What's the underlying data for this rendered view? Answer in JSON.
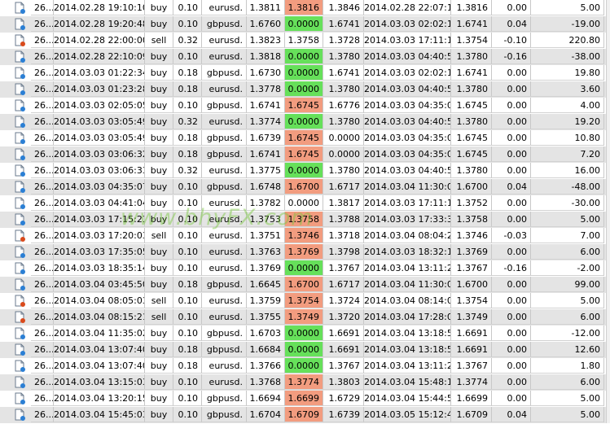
{
  "watermark": "www.bhyFX.com",
  "colors": {
    "loss_highlight": "#f29c7f",
    "profit_highlight": "#66e05a",
    "alt_row": "#e4e4e4"
  },
  "rows": [
    {
      "ticket": "26...",
      "open_time": "2014.02.28 19:10:10",
      "type": "buy",
      "size": "0.10",
      "symbol": "eurusd.",
      "open_price": "1.3811",
      "sl": "1.3816",
      "tp": "1.3846",
      "close_time": "2014.02.28 22:07:17",
      "close_price": "1.3816",
      "commission": "0.00",
      "profit": "5.00",
      "hl": "sl-red",
      "icon": "trade-doc-icon"
    },
    {
      "ticket": "26...",
      "open_time": "2014.02.28 19:20:48",
      "type": "buy",
      "size": "0.10",
      "symbol": "gbpusd.",
      "open_price": "1.6760",
      "sl": "0.0000",
      "tp": "1.6741",
      "close_time": "2014.03.03 02:02:10",
      "close_price": "1.6741",
      "commission": "0.04",
      "profit": "-19.00",
      "hl": "tp-green",
      "icon": "trade-doc-icon"
    },
    {
      "ticket": "26...",
      "open_time": "2014.02.28 22:00:00",
      "type": "sell",
      "size": "0.32",
      "symbol": "eurusd.",
      "open_price": "1.3823",
      "sl": "1.3758",
      "tp": "1.3728",
      "close_time": "2014.03.03 17:11:18",
      "close_price": "1.3754",
      "commission": "-0.10",
      "profit": "220.80",
      "hl": "",
      "icon": "trade-doc-sell-icon"
    },
    {
      "ticket": "26...",
      "open_time": "2014.02.28 22:10:09",
      "type": "buy",
      "size": "0.10",
      "symbol": "eurusd.",
      "open_price": "1.3818",
      "sl": "0.0000",
      "tp": "1.3780",
      "close_time": "2014.03.03 04:40:55",
      "close_price": "1.3780",
      "commission": "-0.16",
      "profit": "-38.00",
      "hl": "tp-green",
      "icon": "trade-doc-icon"
    },
    {
      "ticket": "26...",
      "open_time": "2014.03.03 01:22:34",
      "type": "buy",
      "size": "0.18",
      "symbol": "gbpusd.",
      "open_price": "1.6730",
      "sl": "0.0000",
      "tp": "1.6741",
      "close_time": "2014.03.03 02:02:10",
      "close_price": "1.6741",
      "commission": "0.00",
      "profit": "19.80",
      "hl": "tp-green",
      "icon": "trade-doc-icon"
    },
    {
      "ticket": "26...",
      "open_time": "2014.03.03 01:23:28",
      "type": "buy",
      "size": "0.18",
      "symbol": "eurusd.",
      "open_price": "1.3778",
      "sl": "0.0000",
      "tp": "1.3780",
      "close_time": "2014.03.03 04:40:55",
      "close_price": "1.3780",
      "commission": "0.00",
      "profit": "3.60",
      "hl": "tp-green",
      "icon": "trade-doc-icon"
    },
    {
      "ticket": "26...",
      "open_time": "2014.03.03 02:05:05",
      "type": "buy",
      "size": "0.10",
      "symbol": "gbpusd.",
      "open_price": "1.6741",
      "sl": "1.6745",
      "tp": "1.6776",
      "close_time": "2014.03.03 04:35:00",
      "close_price": "1.6745",
      "commission": "0.00",
      "profit": "4.00",
      "hl": "sl-red",
      "icon": "trade-doc-icon"
    },
    {
      "ticket": "26...",
      "open_time": "2014.03.03 03:05:49",
      "type": "buy",
      "size": "0.32",
      "symbol": "eurusd.",
      "open_price": "1.3774",
      "sl": "0.0000",
      "tp": "1.3780",
      "close_time": "2014.03.03 04:40:55",
      "close_price": "1.3780",
      "commission": "0.00",
      "profit": "19.20",
      "hl": "tp-green",
      "icon": "trade-doc-icon"
    },
    {
      "ticket": "26...",
      "open_time": "2014.03.03 03:05:49",
      "type": "buy",
      "size": "0.18",
      "symbol": "gbpusd.",
      "open_price": "1.6739",
      "sl": "1.6745",
      "tp": "0.0000",
      "close_time": "2014.03.03 04:35:00",
      "close_price": "1.6745",
      "commission": "0.00",
      "profit": "10.80",
      "hl": "sl-red",
      "icon": "trade-doc-icon"
    },
    {
      "ticket": "26...",
      "open_time": "2014.03.03 03:06:32",
      "type": "buy",
      "size": "0.18",
      "symbol": "gbpusd.",
      "open_price": "1.6741",
      "sl": "1.6745",
      "tp": "0.0000",
      "close_time": "2014.03.03 04:35:00",
      "close_price": "1.6745",
      "commission": "0.00",
      "profit": "7.20",
      "hl": "sl-red",
      "icon": "trade-doc-icon"
    },
    {
      "ticket": "26...",
      "open_time": "2014.03.03 03:06:33",
      "type": "buy",
      "size": "0.32",
      "symbol": "eurusd.",
      "open_price": "1.3775",
      "sl": "0.0000",
      "tp": "1.3780",
      "close_time": "2014.03.03 04:40:55",
      "close_price": "1.3780",
      "commission": "0.00",
      "profit": "16.00",
      "hl": "tp-green",
      "icon": "trade-doc-icon"
    },
    {
      "ticket": "26...",
      "open_time": "2014.03.03 04:35:07",
      "type": "buy",
      "size": "0.10",
      "symbol": "gbpusd.",
      "open_price": "1.6748",
      "sl": "1.6700",
      "tp": "1.6717",
      "close_time": "2014.03.04 11:30:00",
      "close_price": "1.6700",
      "commission": "0.04",
      "profit": "-48.00",
      "hl": "sl-red",
      "icon": "trade-doc-icon"
    },
    {
      "ticket": "26...",
      "open_time": "2014.03.03 04:41:04",
      "type": "buy",
      "size": "0.10",
      "symbol": "eurusd.",
      "open_price": "1.3782",
      "sl": "0.0000",
      "tp": "1.3817",
      "close_time": "2014.03.03 17:11:18",
      "close_price": "1.3752",
      "commission": "0.00",
      "profit": "-30.00",
      "hl": "",
      "icon": "trade-doc-icon"
    },
    {
      "ticket": "26...",
      "open_time": "2014.03.03 17:15:23",
      "type": "buy",
      "size": "0.10",
      "symbol": "eurusd.",
      "open_price": "1.3753",
      "sl": "1.3758",
      "tp": "1.3788",
      "close_time": "2014.03.03 17:33:36",
      "close_price": "1.3758",
      "commission": "0.00",
      "profit": "5.00",
      "hl": "sl-red",
      "icon": "trade-doc-icon"
    },
    {
      "ticket": "26...",
      "open_time": "2014.03.03 17:20:03",
      "type": "sell",
      "size": "0.10",
      "symbol": "eurusd.",
      "open_price": "1.3751",
      "sl": "1.3746",
      "tp": "1.3718",
      "close_time": "2014.03.04 08:04:27",
      "close_price": "1.3746",
      "commission": "-0.03",
      "profit": "7.00",
      "hl": "sl-red",
      "icon": "trade-doc-sell-icon"
    },
    {
      "ticket": "26...",
      "open_time": "2014.03.03 17:35:05",
      "type": "buy",
      "size": "0.10",
      "symbol": "eurusd.",
      "open_price": "1.3763",
      "sl": "1.3769",
      "tp": "1.3798",
      "close_time": "2014.03.03 18:32:10",
      "close_price": "1.3769",
      "commission": "0.00",
      "profit": "6.00",
      "hl": "sl-red",
      "icon": "trade-doc-icon"
    },
    {
      "ticket": "26...",
      "open_time": "2014.03.03 18:35:14",
      "type": "buy",
      "size": "0.10",
      "symbol": "eurusd.",
      "open_price": "1.3769",
      "sl": "0.0000",
      "tp": "1.3767",
      "close_time": "2014.03.04 13:11:27",
      "close_price": "1.3767",
      "commission": "-0.16",
      "profit": "-2.00",
      "hl": "tp-green",
      "icon": "trade-doc-icon"
    },
    {
      "ticket": "26...",
      "open_time": "2014.03.04 03:45:50",
      "type": "buy",
      "size": "0.18",
      "symbol": "gbpusd.",
      "open_price": "1.6645",
      "sl": "1.6700",
      "tp": "1.6717",
      "close_time": "2014.03.04 11:30:00",
      "close_price": "1.6700",
      "commission": "0.00",
      "profit": "99.00",
      "hl": "sl-red",
      "icon": "trade-doc-icon"
    },
    {
      "ticket": "26...",
      "open_time": "2014.03.04 08:05:03",
      "type": "sell",
      "size": "0.10",
      "symbol": "eurusd.",
      "open_price": "1.3759",
      "sl": "1.3754",
      "tp": "1.3724",
      "close_time": "2014.03.04 08:14:05",
      "close_price": "1.3754",
      "commission": "0.00",
      "profit": "5.00",
      "hl": "sl-red",
      "icon": "trade-doc-sell-icon"
    },
    {
      "ticket": "26...",
      "open_time": "2014.03.04 08:15:21",
      "type": "sell",
      "size": "0.10",
      "symbol": "eurusd.",
      "open_price": "1.3755",
      "sl": "1.3749",
      "tp": "1.3720",
      "close_time": "2014.03.04 17:28:09",
      "close_price": "1.3749",
      "commission": "0.00",
      "profit": "6.00",
      "hl": "sl-red",
      "icon": "trade-doc-sell-icon"
    },
    {
      "ticket": "26...",
      "open_time": "2014.03.04 11:35:02",
      "type": "buy",
      "size": "0.10",
      "symbol": "gbpusd.",
      "open_price": "1.6703",
      "sl": "0.0000",
      "tp": "1.6691",
      "close_time": "2014.03.04 13:18:59",
      "close_price": "1.6691",
      "commission": "0.00",
      "profit": "-12.00",
      "hl": "tp-green",
      "icon": "trade-doc-icon"
    },
    {
      "ticket": "26...",
      "open_time": "2014.03.04 13:07:40",
      "type": "buy",
      "size": "0.18",
      "symbol": "gbpusd.",
      "open_price": "1.6684",
      "sl": "0.0000",
      "tp": "1.6691",
      "close_time": "2014.03.04 13:18:59",
      "close_price": "1.6691",
      "commission": "0.00",
      "profit": "12.60",
      "hl": "tp-green",
      "icon": "trade-doc-icon"
    },
    {
      "ticket": "26...",
      "open_time": "2014.03.04 13:07:40",
      "type": "buy",
      "size": "0.18",
      "symbol": "eurusd.",
      "open_price": "1.3766",
      "sl": "0.0000",
      "tp": "1.3767",
      "close_time": "2014.03.04 13:11:27",
      "close_price": "1.3767",
      "commission": "0.00",
      "profit": "1.80",
      "hl": "tp-green",
      "icon": "trade-doc-icon"
    },
    {
      "ticket": "26...",
      "open_time": "2014.03.04 13:15:03",
      "type": "buy",
      "size": "0.10",
      "symbol": "eurusd.",
      "open_price": "1.3768",
      "sl": "1.3774",
      "tp": "1.3803",
      "close_time": "2014.03.04 15:48:11",
      "close_price": "1.3774",
      "commission": "0.00",
      "profit": "6.00",
      "hl": "sl-red",
      "icon": "trade-doc-icon"
    },
    {
      "ticket": "26...",
      "open_time": "2014.03.04 13:20:15",
      "type": "buy",
      "size": "0.10",
      "symbol": "gbpusd.",
      "open_price": "1.6694",
      "sl": "1.6699",
      "tp": "1.6729",
      "close_time": "2014.03.04 15:44:53",
      "close_price": "1.6699",
      "commission": "0.00",
      "profit": "5.00",
      "hl": "sl-red",
      "icon": "trade-doc-icon"
    },
    {
      "ticket": "26...",
      "open_time": "2014.03.04 15:45:03",
      "type": "buy",
      "size": "0.10",
      "symbol": "gbpusd.",
      "open_price": "1.6704",
      "sl": "1.6709",
      "tp": "1.6739",
      "close_time": "2014.03.05 15:12:41",
      "close_price": "1.6709",
      "commission": "0.04",
      "profit": "5.00",
      "hl": "sl-red",
      "icon": "trade-doc-icon"
    }
  ]
}
